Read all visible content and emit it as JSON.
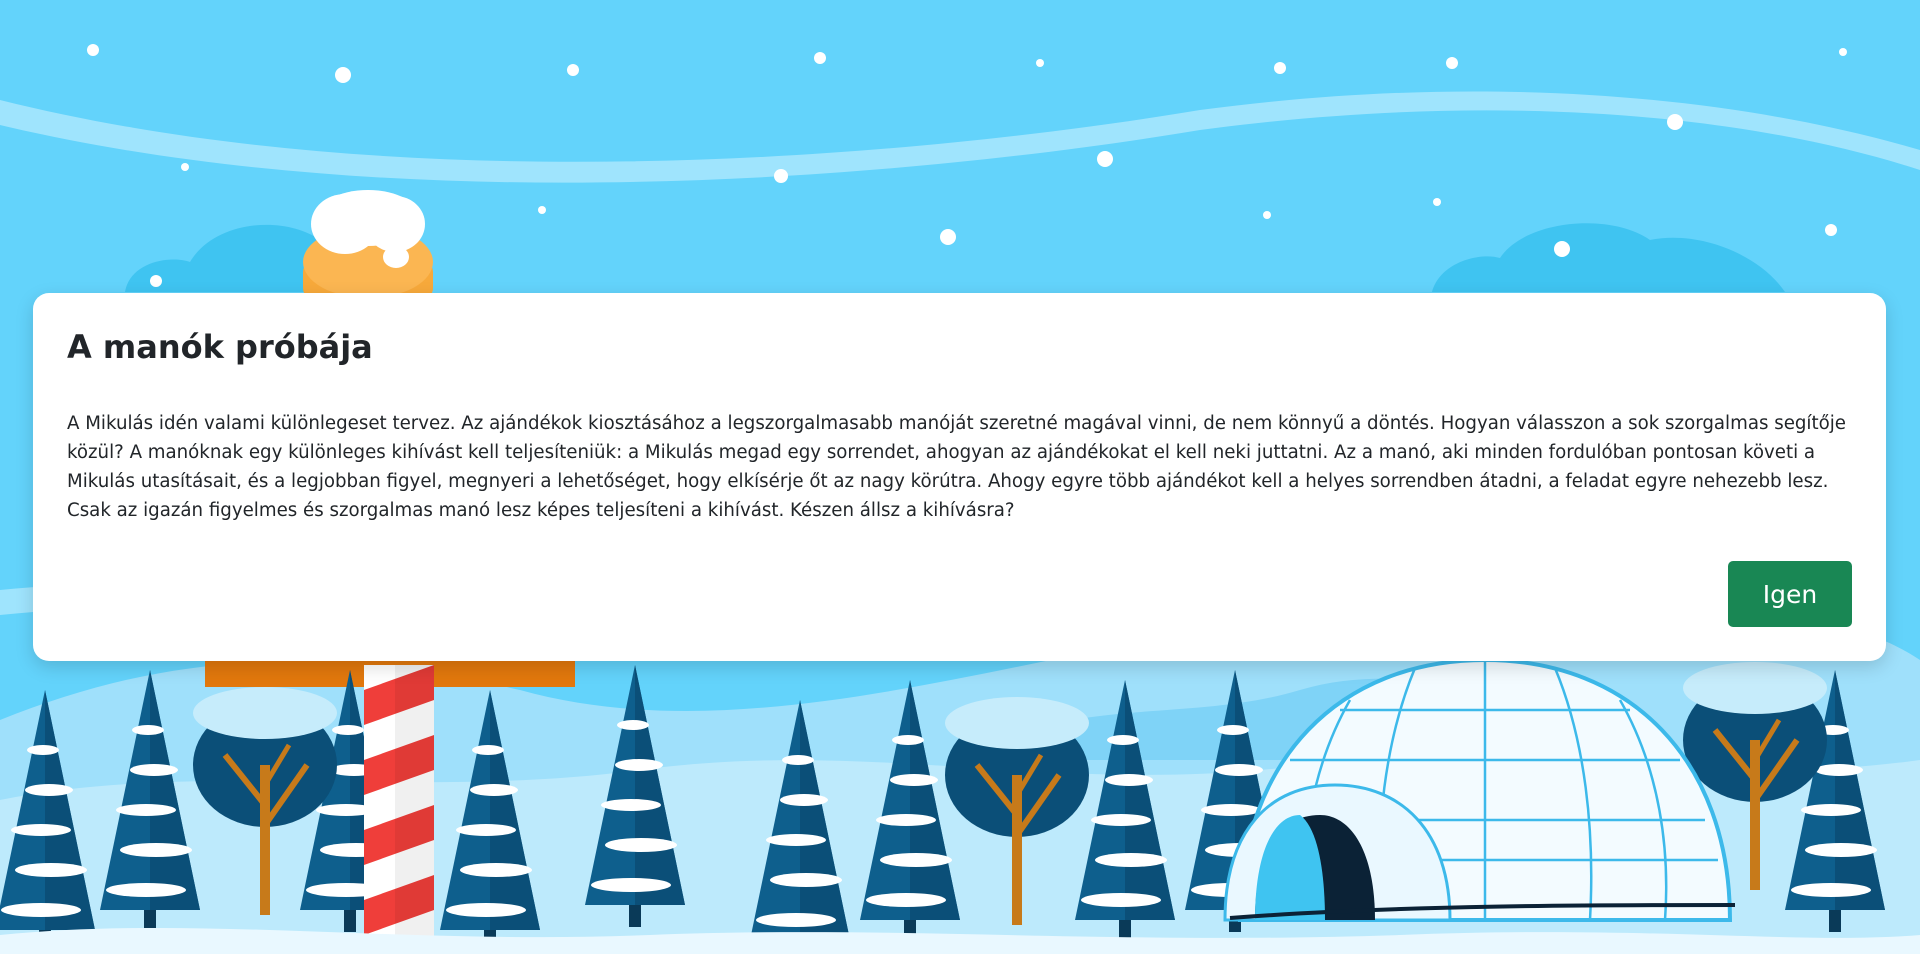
{
  "dialog": {
    "title": "A manók próbája",
    "text": "A Mikulás idén valami különlegeset tervez. Az ajándékok kiosztásához a legszorgalmasabb manóját szeretné magával vinni, de nem könnyű a döntés. Hogyan válasszon a sok szorgalmas segítője közül? A manóknak egy különleges kihívást kell teljesíteniük: a Mikulás megad egy sorrendet, ahogyan az ajándékokat el kell neki juttatni. Az a manó, aki minden fordulóban pontosan követi a Mikulás utasításait, és a legjobban figyel, megnyeri a lehetőséget, hogy elkísérje őt az nagy körútra. Ahogy egyre több ajándékot kell a helyes sorrendben átadni, a feladat egyre nehezebb lesz. Csak az igazán figyelmes és szorgalmas manó lesz képes teljesíteni a kihívást. Készen állsz a kihívásra?",
    "confirm_label": "Igen"
  },
  "colors": {
    "sky": "#63d3fb",
    "button": "#198754",
    "tree_dark": "#0e5f8d",
    "pole_red": "#ef3e3a"
  }
}
